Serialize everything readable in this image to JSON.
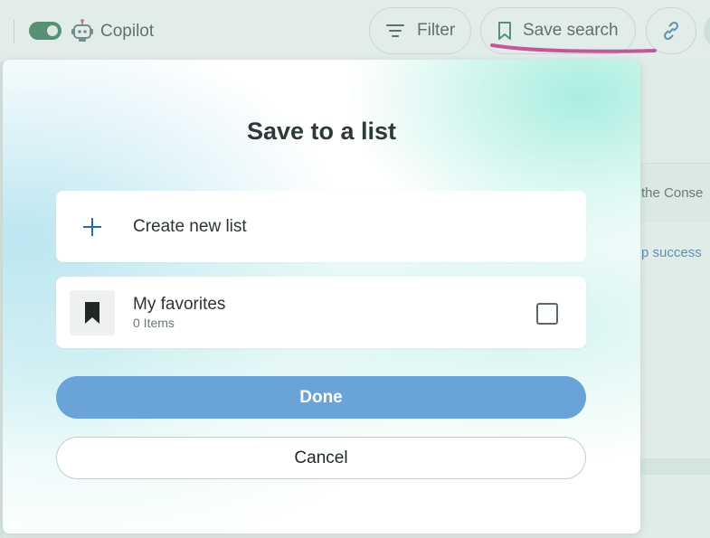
{
  "topbar": {
    "copilot_label": "Copilot",
    "copilot_toggle_on": true,
    "filter_label": "Filter",
    "save_search_label": "Save search"
  },
  "background": {
    "snippet_1": "the Conse",
    "snippet_2": "p success"
  },
  "dialog": {
    "title": "Save to a list",
    "create_new_list_label": "Create new list",
    "lists": [
      {
        "name": "My favorites",
        "count": "0 Items",
        "checked": false,
        "icon": "bookmark-icon"
      }
    ],
    "done_label": "Done",
    "cancel_label": "Cancel"
  },
  "colors": {
    "accent_blue": "#2b6aa8",
    "done_button": "#6aa3d8",
    "toggle_green": "#226b44",
    "highlight_mark": "#c2187a",
    "title_text": "#2c3a38"
  }
}
